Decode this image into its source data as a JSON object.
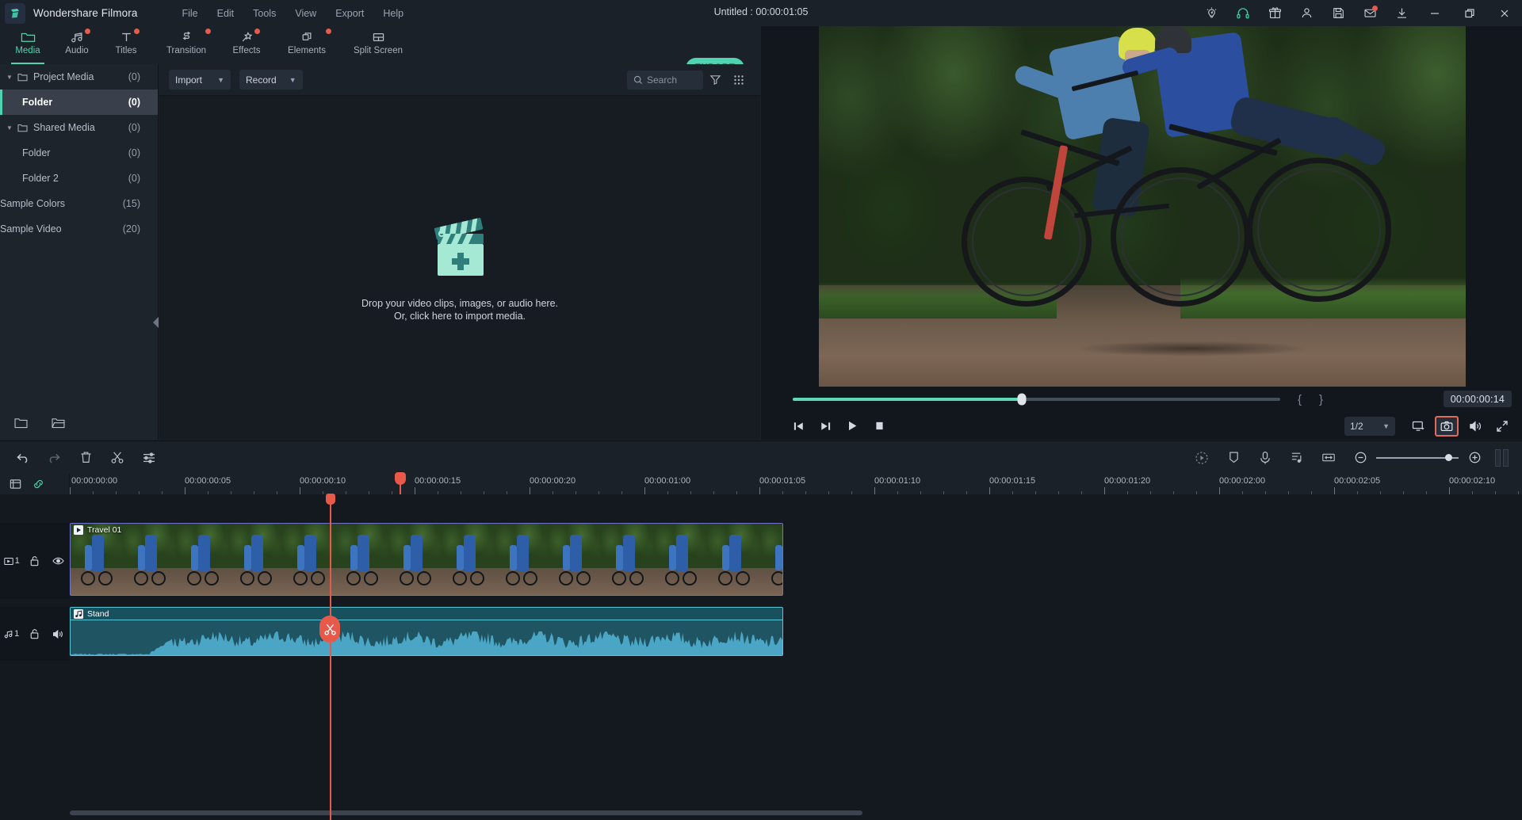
{
  "titlebar": {
    "app_name": "Wondershare Filmora",
    "project_title": "Untitled : 00:00:01:05",
    "menus": [
      "File",
      "Edit",
      "Tools",
      "View",
      "Export",
      "Help"
    ],
    "right_icons": [
      {
        "name": "idea-icon",
        "label": "Idea"
      },
      {
        "name": "headset-icon",
        "label": "Support"
      },
      {
        "name": "gift-icon",
        "label": "Gift"
      },
      {
        "name": "account-icon",
        "label": "Account"
      },
      {
        "name": "save-icon",
        "label": "Save"
      },
      {
        "name": "mail-icon",
        "label": "Messages"
      },
      {
        "name": "download-icon",
        "label": "Downloads"
      }
    ],
    "window_buttons": [
      "minimize",
      "maximize",
      "close"
    ]
  },
  "navtabs": {
    "items": [
      {
        "label": "Media",
        "icon": "folder-icon",
        "active": true,
        "badge": false
      },
      {
        "label": "Audio",
        "icon": "music-note-icon",
        "active": false,
        "badge": true
      },
      {
        "label": "Titles",
        "icon": "text-t-icon",
        "active": false,
        "badge": true
      },
      {
        "label": "Transition",
        "icon": "transition-arrows-icon",
        "active": false,
        "badge": true
      },
      {
        "label": "Effects",
        "icon": "magic-wand-icon",
        "active": false,
        "badge": true
      },
      {
        "label": "Elements",
        "icon": "shapes-icon",
        "active": false,
        "badge": true
      },
      {
        "label": "Split Screen",
        "icon": "split-screen-icon",
        "active": false,
        "badge": false
      }
    ],
    "export_label": "EXPORT",
    "accent_color": "#4fd3b0"
  },
  "sidebar": {
    "items": [
      {
        "label": "Project Media",
        "count": "(0)",
        "type": "group",
        "expanded": true,
        "selected": false
      },
      {
        "label": "Folder",
        "count": "(0)",
        "type": "child",
        "selected": true
      },
      {
        "label": "Shared Media",
        "count": "(0)",
        "type": "group",
        "expanded": true,
        "selected": false
      },
      {
        "label": "Folder",
        "count": "(0)",
        "type": "child",
        "selected": false
      },
      {
        "label": "Folder 2",
        "count": "(0)",
        "type": "child",
        "selected": false
      },
      {
        "label": "Sample Colors",
        "count": "(15)",
        "type": "flat",
        "selected": false
      },
      {
        "label": "Sample Video",
        "count": "(20)",
        "type": "flat",
        "selected": false
      }
    ],
    "bottom_buttons": [
      {
        "name": "new-folder-icon"
      },
      {
        "name": "open-folder-icon"
      }
    ]
  },
  "media_panel": {
    "import_label": "Import",
    "record_label": "Record",
    "search_placeholder": "Search",
    "search_value": "",
    "filter_icon": "filter-funnel-icon",
    "grid_icon": "grid-view-icon",
    "dropzone_line1": "Drop your video clips, images, or audio here.",
    "dropzone_line2": "Or, click here to import media.",
    "dropzone_icon": "clapperboard-plus-icon"
  },
  "player": {
    "progress_percent": 47,
    "mark_in_label": "{",
    "mark_out_label": "}",
    "timecode": "00:00:00:14",
    "speed": "1/2",
    "controls": [
      {
        "name": "prev-frame-button",
        "label": "Previous frame"
      },
      {
        "name": "next-frame-button",
        "label": "Next frame"
      },
      {
        "name": "play-button",
        "label": "Play"
      },
      {
        "name": "stop-button",
        "label": "Stop"
      }
    ],
    "right_controls": [
      {
        "name": "display-settings-button"
      },
      {
        "name": "snapshot-button",
        "highlighted": true,
        "highlight_color": "#e06a5b"
      },
      {
        "name": "volume-button"
      },
      {
        "name": "fullscreen-button"
      }
    ]
  },
  "timeline_toolbar": {
    "left_buttons": [
      {
        "name": "undo-button",
        "icon": "undo-arrow-icon"
      },
      {
        "name": "redo-button",
        "icon": "redo-arrow-icon"
      },
      {
        "name": "delete-button",
        "icon": "trash-icon"
      },
      {
        "name": "split-button",
        "icon": "scissors-icon"
      },
      {
        "name": "settings-button",
        "icon": "sliders-icon"
      }
    ],
    "right_buttons": [
      {
        "name": "render-preview-button",
        "icon": "render-play-icon"
      },
      {
        "name": "marker-button",
        "icon": "marker-flag-icon"
      },
      {
        "name": "voiceover-button",
        "icon": "microphone-icon"
      },
      {
        "name": "audio-detach-button",
        "icon": "audio-list-icon"
      },
      {
        "name": "fit-timeline-button",
        "icon": "fit-width-icon"
      },
      {
        "name": "zoom-out-button",
        "icon": "minus-circle-icon"
      },
      {
        "name": "zoom-slider",
        "icon": "slider"
      },
      {
        "name": "zoom-in-button",
        "icon": "plus-circle-icon"
      }
    ]
  },
  "timeline": {
    "head_icons": [
      {
        "name": "add-track-icon"
      },
      {
        "name": "link-icon"
      }
    ],
    "ruler_labels": [
      "00:00:00:00",
      "00:00:00:05",
      "00:00:00:10",
      "00:00:00:15",
      "00:00:00:20",
      "00:00:01:00",
      "00:00:01:05",
      "00:00:01:10",
      "00:00:01:15",
      "00:00:01:20",
      "00:00:02:00",
      "00:00:02:05",
      "00:00:02:10"
    ],
    "playhead_time": "00:00:00:14",
    "tracks": [
      {
        "kind": "video",
        "index_label": "1",
        "index_icon": "video-track-icon",
        "lock_icon": "unlocked-icon",
        "visibility_icon": "eye-icon",
        "clip": {
          "name": "Travel 01",
          "icon": "play-clip-icon"
        }
      },
      {
        "kind": "audio",
        "index_label": "1",
        "index_icon": "audio-track-icon",
        "lock_icon": "unlocked-icon",
        "visibility_icon": "speaker-icon",
        "clip": {
          "name": "Stand",
          "icon": "music-clip-icon"
        }
      }
    ],
    "split_marker_icon": "scissors-icon"
  },
  "colors": {
    "accent": "#4fd3b0",
    "playhead": "#e8594a",
    "badge": "#e85b4a",
    "video_clip_border": "#6f74c6",
    "audio_clip_border": "#59c6d8"
  }
}
